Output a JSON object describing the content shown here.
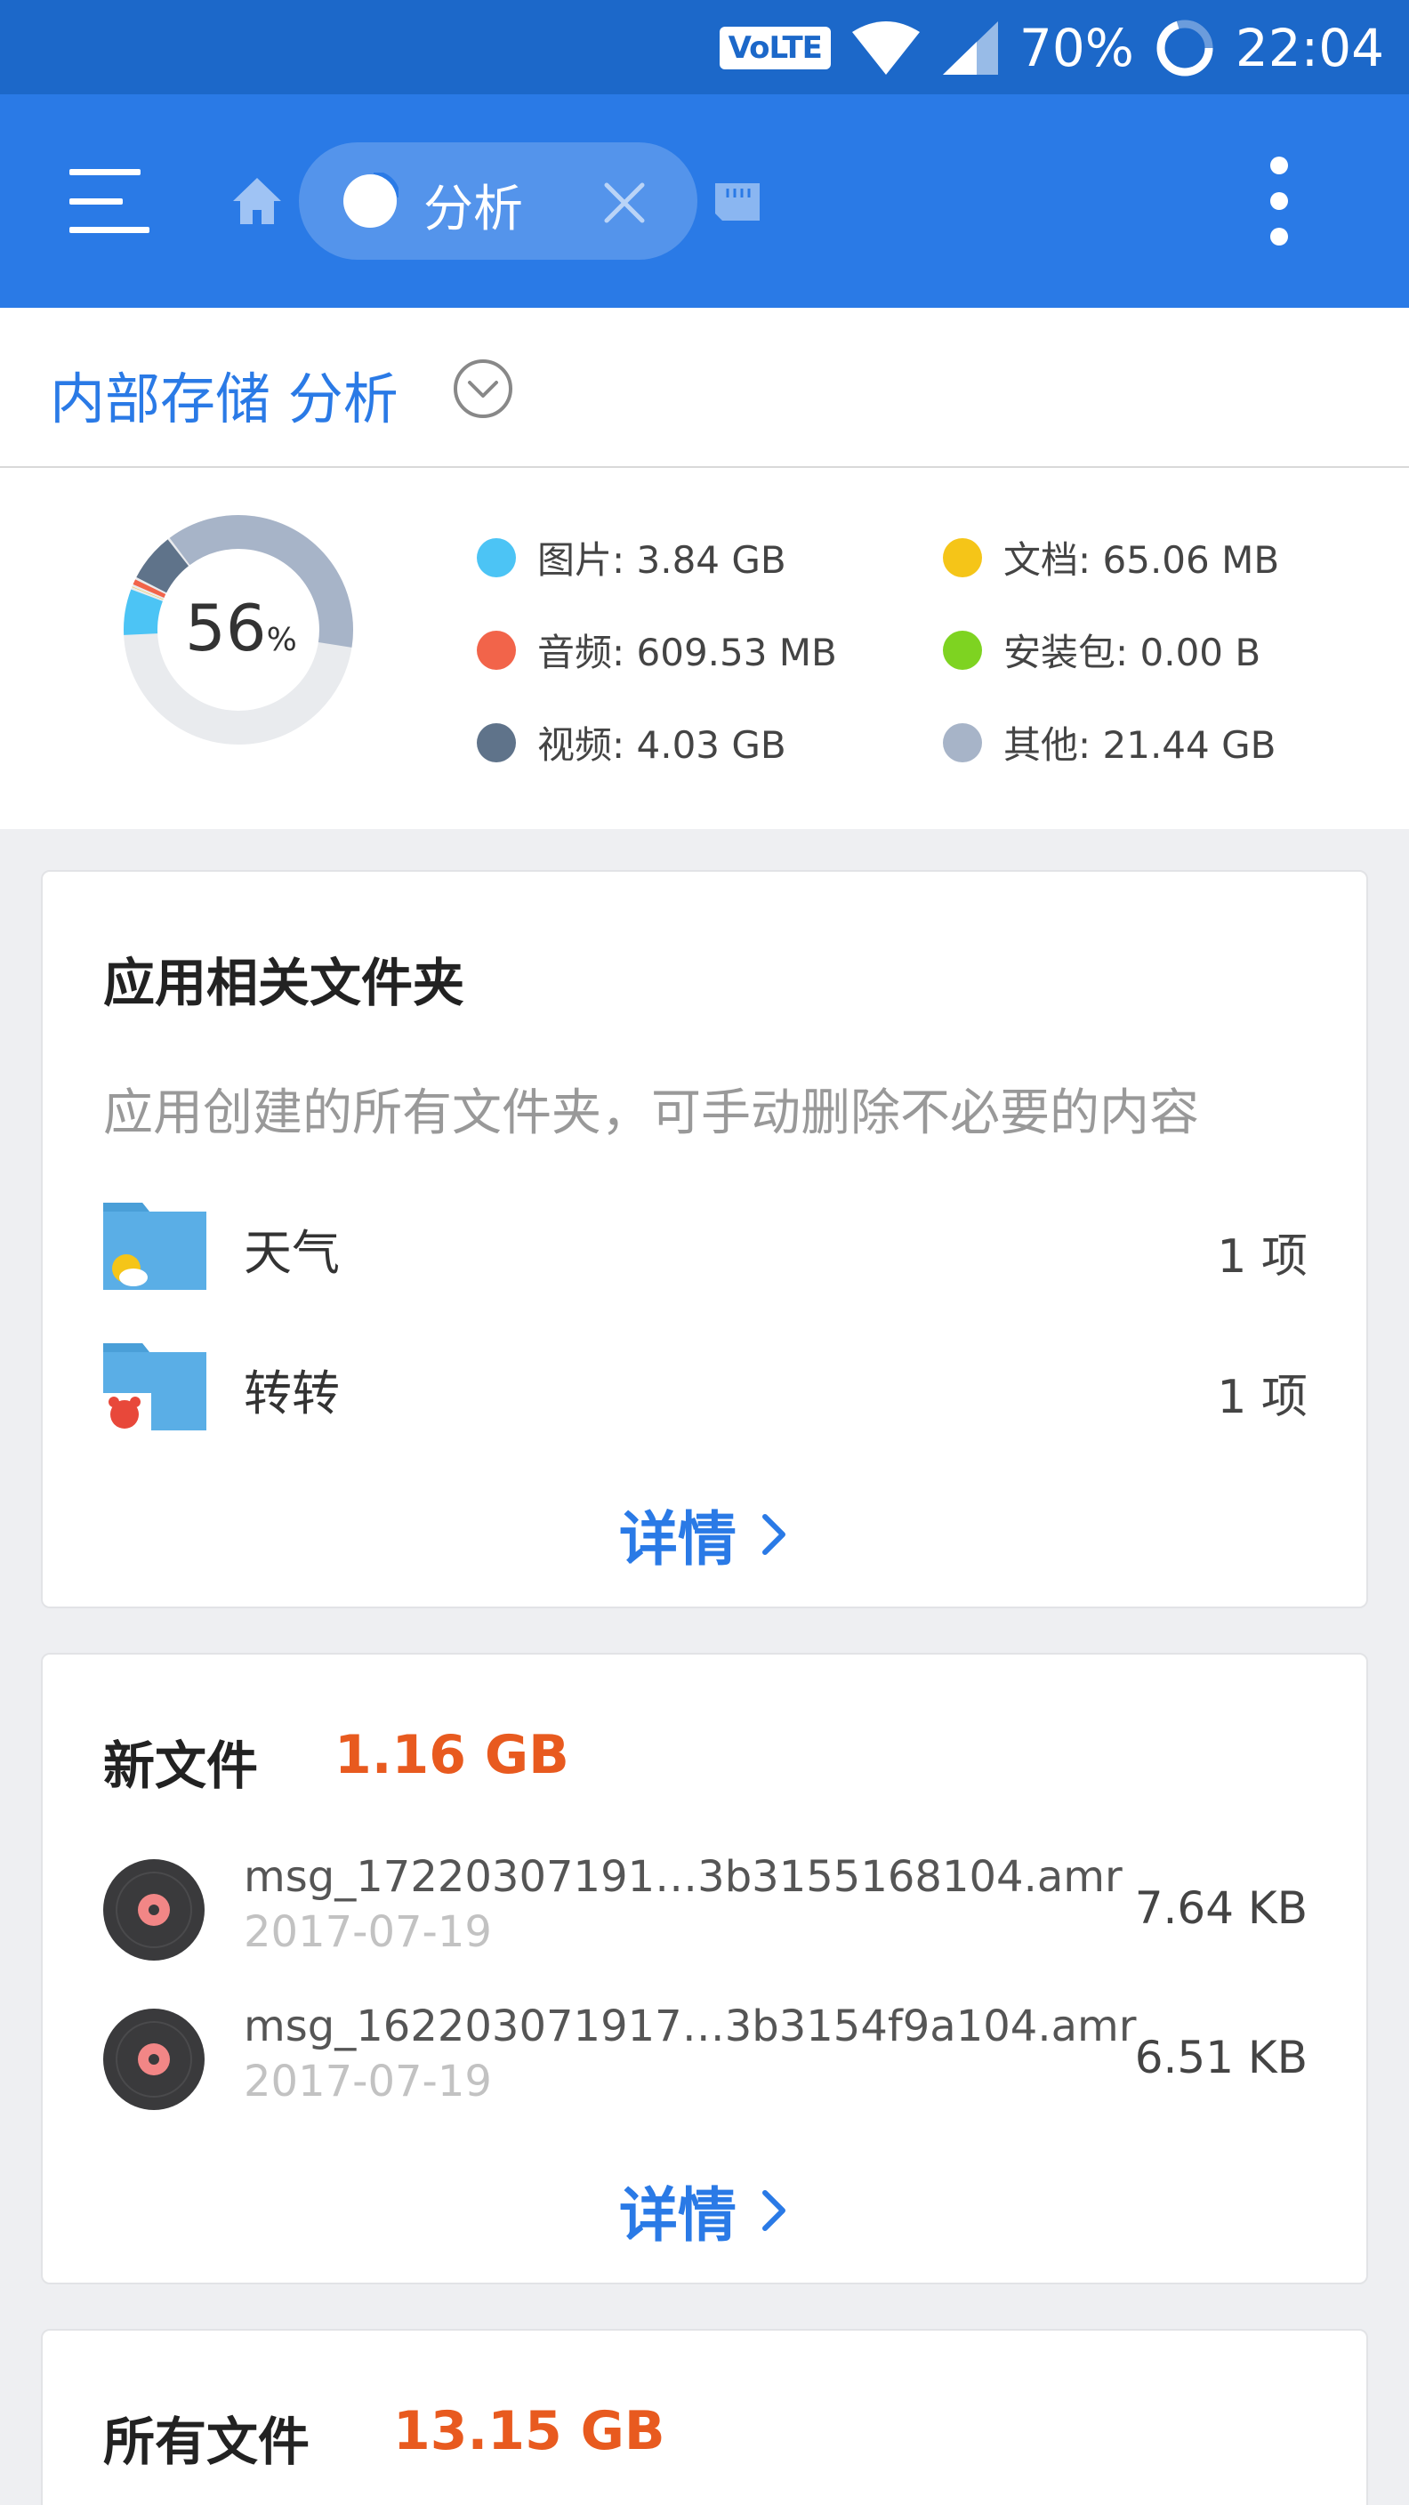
{
  "status_bar": {
    "network_badge": "VoLTE",
    "battery": "70%",
    "time": "22:04"
  },
  "app_bar": {
    "active_tab_label": "分析"
  },
  "storage": {
    "title": "内部存储 分析",
    "used_percent": "56",
    "percent_sign": "%",
    "donut_segments": [
      {
        "category": "其他",
        "fraction": 0.38,
        "color": "#a7b4c8"
      },
      {
        "category": "视频",
        "fraction": 0.072,
        "color": "#5f738a"
      },
      {
        "category": "音频",
        "fraction": 0.011,
        "color": "#f2644a"
      },
      {
        "category": "文档",
        "fraction": 0.004,
        "color": "#f5c518"
      },
      {
        "category": "图片",
        "fraction": 0.068,
        "color": "#4cc4f5"
      }
    ],
    "legend": [
      {
        "label": "图片: 3.84 GB",
        "color": "#4cc4f5"
      },
      {
        "label": "文档: 65.06 MB",
        "color": "#f5c518"
      },
      {
        "label": "音频: 609.53 MB",
        "color": "#f2644a"
      },
      {
        "label": "安装包: 0.00 B",
        "color": "#7ed321"
      },
      {
        "label": "视频: 4.03 GB",
        "color": "#5f738a"
      },
      {
        "label": "其他: 21.44 GB",
        "color": "#a7b4c8"
      }
    ]
  },
  "app_folders": {
    "title": "应用相关文件夹",
    "description": "应用创建的所有文件夹，可手动删除不必要的内容",
    "items": [
      {
        "name": "天气",
        "count": "1 项"
      },
      {
        "name": "转转",
        "count": "1 项"
      }
    ],
    "details_label": "详情"
  },
  "new_files": {
    "title": "新文件",
    "size": "1.16 GB",
    "items": [
      {
        "name": "msg_17220307191…3b3155168104.amr",
        "date": "2017-07-19",
        "size": "7.64 KB"
      },
      {
        "name": "msg_162203071917…3b3154f9a104.amr",
        "date": "2017-07-19",
        "size": "6.51 KB"
      }
    ],
    "details_label": "详情"
  },
  "all_files": {
    "title": "所有文件",
    "size": "13.15 GB"
  }
}
